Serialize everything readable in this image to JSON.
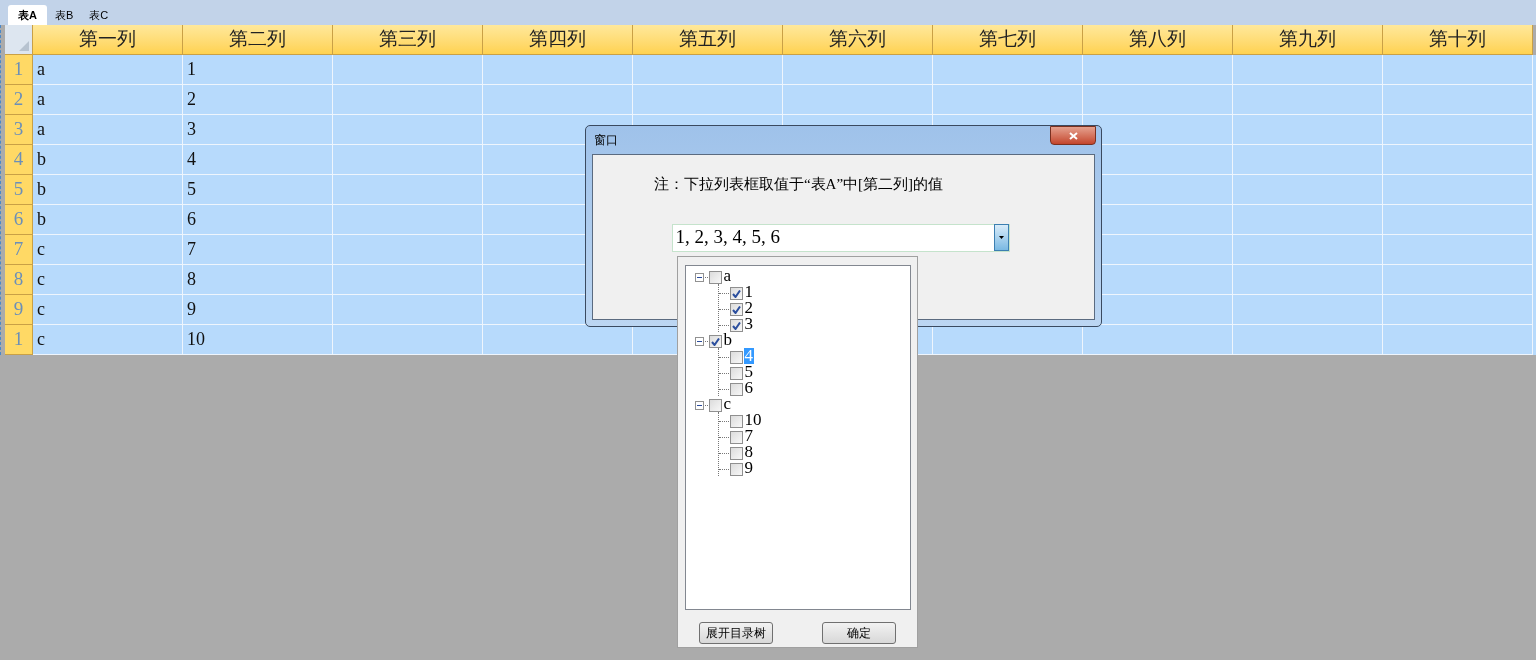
{
  "tabs": [
    {
      "label": "表A",
      "selected": true
    },
    {
      "label": "表B",
      "selected": false
    },
    {
      "label": "表C",
      "selected": false
    }
  ],
  "table": {
    "columns": [
      "第一列",
      "第二列",
      "第三列",
      "第四列",
      "第五列",
      "第六列",
      "第七列",
      "第八列",
      "第九列",
      "第十列"
    ],
    "rows": [
      {
        "number": "1",
        "cells": [
          "a",
          "1"
        ]
      },
      {
        "number": "2",
        "cells": [
          "a",
          "2"
        ]
      },
      {
        "number": "3",
        "cells": [
          "a",
          "3"
        ]
      },
      {
        "number": "4",
        "cells": [
          "b",
          "4"
        ]
      },
      {
        "number": "5",
        "cells": [
          "b",
          "5"
        ]
      },
      {
        "number": "6",
        "cells": [
          "b",
          "6"
        ]
      },
      {
        "number": "7",
        "cells": [
          "c",
          "7"
        ]
      },
      {
        "number": "8",
        "cells": [
          "c",
          "8"
        ]
      },
      {
        "number": "9",
        "cells": [
          "c",
          "9"
        ]
      },
      {
        "number": "1",
        "cells": [
          "c",
          "10"
        ]
      }
    ]
  },
  "dialog": {
    "title": "窗口",
    "note": "注：下拉列表框取值于“表A”中[第二列]的值",
    "combo": {
      "value": "1, 2, 3, 4, 5, 6"
    },
    "tree": [
      {
        "label": "a",
        "checked": false,
        "expanded": true,
        "selected": false,
        "children": [
          {
            "label": "1",
            "checked": true,
            "selected": false
          },
          {
            "label": "2",
            "checked": true,
            "selected": false
          },
          {
            "label": "3",
            "checked": true,
            "selected": false
          }
        ]
      },
      {
        "label": "b",
        "checked": true,
        "expanded": true,
        "selected": false,
        "children": [
          {
            "label": "4",
            "checked": false,
            "selected": true
          },
          {
            "label": "5",
            "checked": false,
            "selected": false
          },
          {
            "label": "6",
            "checked": false,
            "selected": false
          }
        ]
      },
      {
        "label": "c",
        "checked": false,
        "expanded": true,
        "selected": false,
        "children": [
          {
            "label": "10",
            "checked": false,
            "selected": false
          },
          {
            "label": "7",
            "checked": false,
            "selected": false
          },
          {
            "label": "8",
            "checked": false,
            "selected": false
          },
          {
            "label": "9",
            "checked": false,
            "selected": false
          }
        ]
      }
    ],
    "buttons": [
      "展开目录树",
      "确定"
    ]
  }
}
